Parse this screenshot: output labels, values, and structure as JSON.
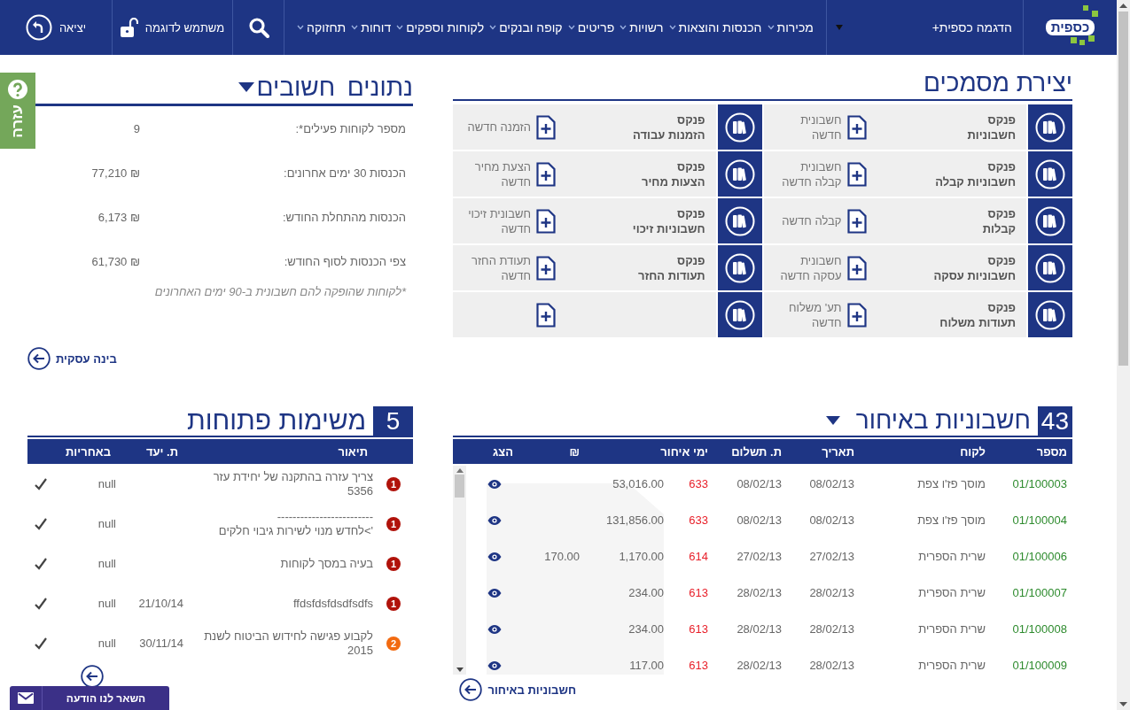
{
  "header": {
    "logo": "כספית",
    "company": "הדגמה כספית+",
    "nav": [
      "מכירות",
      "הכנסות והוצאות",
      "רשויות",
      "פריטים",
      "קופה ובנקים",
      "לקוחות וספקים",
      "דוחות",
      "תחזוקה"
    ],
    "user": "משתמש לדוגמה",
    "exit": "יציאה"
  },
  "help_tab": {
    "label": "עזרה"
  },
  "documents": {
    "title": "יצירת מסמכים",
    "rows": [
      [
        {
          "book": "פנקס\nחשבוניות",
          "new": "חשבונית\nחדשה"
        },
        {
          "book": "פנקס\nהזמנות עבודה",
          "new": "הזמנה חדשה"
        }
      ],
      [
        {
          "book": "פנקס\nחשבוניות קבלה",
          "new": "חשבונית\nקבלה חדשה"
        },
        {
          "book": "פנקס\nהצעות מחיר",
          "new": "הצעת מחיר\nחדשה"
        }
      ],
      [
        {
          "book": "פנקס\nקבלות",
          "new": "קבלה חדשה"
        },
        {
          "book": "פנקס\nחשבוניות זיכוי",
          "new": "חשבונית זיכוי\nחדשה"
        }
      ],
      [
        {
          "book": "פנקס\nחשבוניות עסקה",
          "new": "חשבונית\nעסקה חדשה"
        },
        {
          "book": "פנקס\nתעודות החזר",
          "new": "תעודת החזר\nחדשה"
        }
      ],
      [
        {
          "book": "פנקס\nתעודות משלוח",
          "new": "תע' משלוח\nחדשה"
        },
        {}
      ]
    ]
  },
  "stats": {
    "title": "נתונים חשובים",
    "items": [
      {
        "label": "מספר לקוחות פעילים*:",
        "value": "9"
      },
      {
        "label": "הכנסות 30 ימים אחרונים:",
        "value": "₪ 77,210"
      },
      {
        "label": "הכנסות מהתחלת החודש:",
        "value": "₪ 6,173"
      },
      {
        "label": "צפי הכנסות לסוף החודש:",
        "value": "₪ 61,730"
      }
    ],
    "note": "*לקוחות שהופקה להם חשבונית ב-90 ימים האחרונים",
    "link": "בינה עסקית"
  },
  "late_invoices": {
    "count": "43",
    "title": "חשבוניות באיחור",
    "columns": [
      "מספר",
      "לקוח",
      "תאריך",
      "ת. תשלום",
      "ימי איחור",
      "₪",
      "הצג"
    ],
    "rows": [
      {
        "number": "01/100003",
        "customer": "מוסך פז'ו צפת",
        "date": "08/02/13",
        "pay_date": "08/02/13",
        "days": "633",
        "amount": "53,016.00"
      },
      {
        "number": "01/100004",
        "customer": "מוסך פז'ו צפת",
        "date": "08/02/13",
        "pay_date": "08/02/13",
        "days": "633",
        "amount": "131,856.00"
      },
      {
        "number": "01/100006",
        "customer": "שרית הספרית",
        "date": "27/02/13",
        "pay_date": "27/02/13",
        "days": "614",
        "amount": "1,170.00",
        "paid": "170.00"
      },
      {
        "number": "01/100007",
        "customer": "שרית הספרית",
        "date": "28/02/13",
        "pay_date": "28/02/13",
        "days": "613",
        "amount": "234.00"
      },
      {
        "number": "01/100008",
        "customer": "שרית הספרית",
        "date": "28/02/13",
        "pay_date": "28/02/13",
        "days": "613",
        "amount": "234.00"
      },
      {
        "number": "01/100009",
        "customer": "שרית הספרית",
        "date": "28/02/13",
        "pay_date": "28/02/13",
        "days": "613",
        "amount": "117.00"
      }
    ],
    "link": "חשבוניות באיחור"
  },
  "tasks": {
    "count": "5",
    "title": "משימות פתוחות",
    "columns": [
      "תיאור",
      "ת. יעד",
      "באחריות"
    ],
    "rows": [
      {
        "priority": "1",
        "color": "#b0120a",
        "description": "צריך עזרה בהתקנה של יחידת עזר 5356",
        "owner": "null"
      },
      {
        "priority": "1",
        "color": "#b0120a",
        "description": "-------------------------\n'>לחדש מנוי לשירות גיבוי חלקים",
        "owner": "null"
      },
      {
        "priority": "1",
        "color": "#b0120a",
        "description": "בעיה במסך לקוחות",
        "owner": "null"
      },
      {
        "priority": "1",
        "color": "#b0120a",
        "description": "ffdsfdsfdsdfsdfs",
        "due": "21/10/14",
        "owner": "null"
      },
      {
        "priority": "2",
        "color": "#f26a10",
        "description": "לקבוע פגישה לחידוש הביטוח לשנת 2015",
        "due": "30/11/14",
        "owner": "null"
      }
    ]
  },
  "message_bar": {
    "label": "השאר לנו הודעה"
  }
}
